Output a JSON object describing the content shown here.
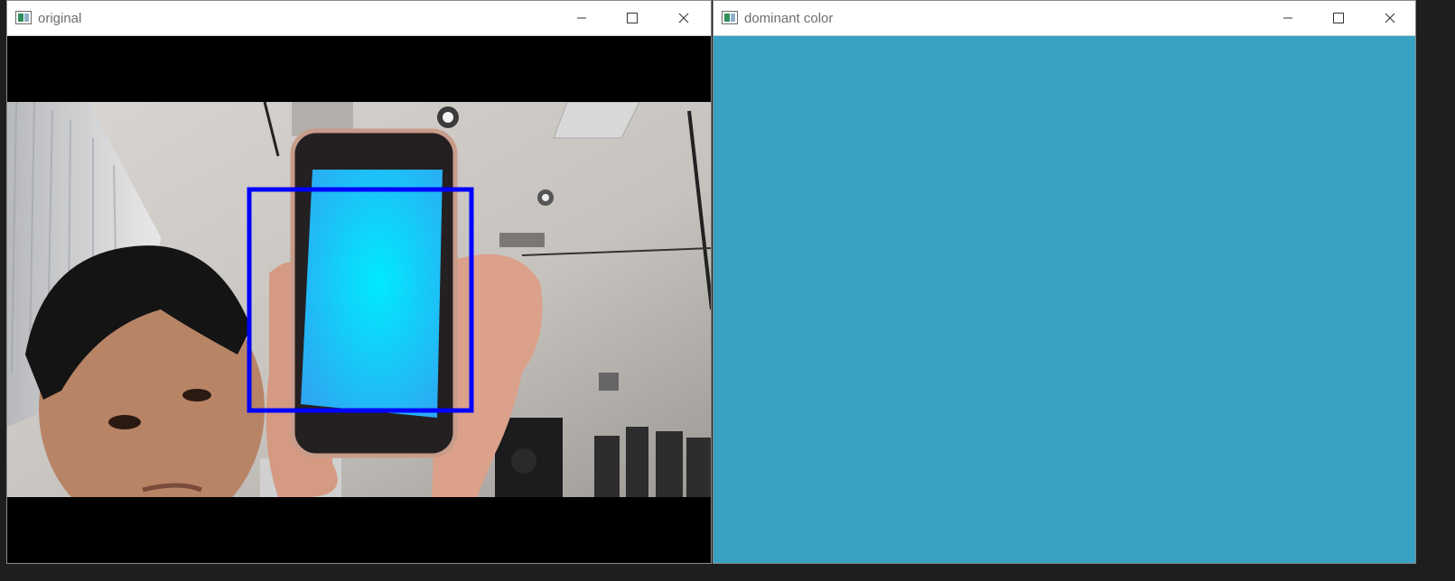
{
  "windows": [
    {
      "title": "original",
      "controls": {
        "minimize": "minimize",
        "maximize": "maximize",
        "close": "close"
      }
    },
    {
      "title": "dominant color",
      "controls": {
        "minimize": "minimize",
        "maximize": "maximize",
        "close": "close"
      },
      "color": "#37a2c4"
    }
  ],
  "colors": {
    "detection_box": "#0000ff",
    "phone_screen": "#00d8f0",
    "letterbox": "#000000"
  },
  "icons": [
    "app-icon",
    "minimize-icon",
    "maximize-icon",
    "close-icon"
  ]
}
